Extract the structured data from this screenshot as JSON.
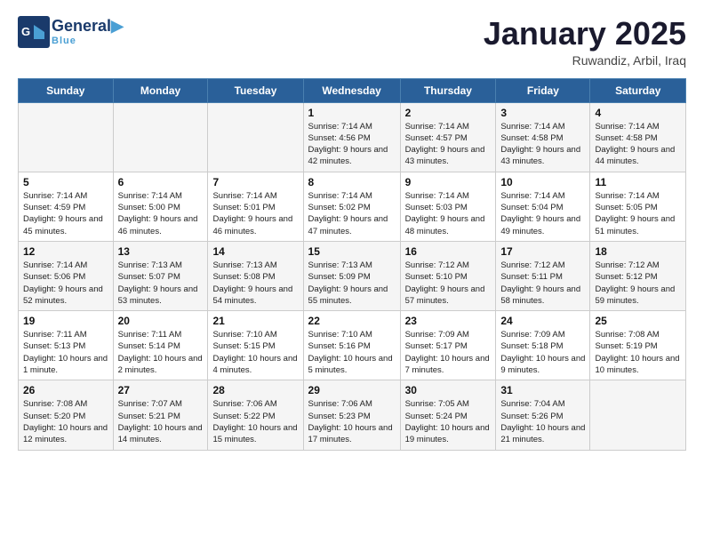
{
  "header": {
    "logo_general": "General",
    "logo_blue": "Blue",
    "title": "January 2025",
    "location": "Ruwandiz, Arbil, Iraq"
  },
  "days_of_week": [
    "Sunday",
    "Monday",
    "Tuesday",
    "Wednesday",
    "Thursday",
    "Friday",
    "Saturday"
  ],
  "weeks": [
    [
      {
        "day": "",
        "sunrise": "",
        "sunset": "",
        "daylight": ""
      },
      {
        "day": "",
        "sunrise": "",
        "sunset": "",
        "daylight": ""
      },
      {
        "day": "",
        "sunrise": "",
        "sunset": "",
        "daylight": ""
      },
      {
        "day": "1",
        "sunrise": "Sunrise: 7:14 AM",
        "sunset": "Sunset: 4:56 PM",
        "daylight": "Daylight: 9 hours and 42 minutes."
      },
      {
        "day": "2",
        "sunrise": "Sunrise: 7:14 AM",
        "sunset": "Sunset: 4:57 PM",
        "daylight": "Daylight: 9 hours and 43 minutes."
      },
      {
        "day": "3",
        "sunrise": "Sunrise: 7:14 AM",
        "sunset": "Sunset: 4:58 PM",
        "daylight": "Daylight: 9 hours and 43 minutes."
      },
      {
        "day": "4",
        "sunrise": "Sunrise: 7:14 AM",
        "sunset": "Sunset: 4:58 PM",
        "daylight": "Daylight: 9 hours and 44 minutes."
      }
    ],
    [
      {
        "day": "5",
        "sunrise": "Sunrise: 7:14 AM",
        "sunset": "Sunset: 4:59 PM",
        "daylight": "Daylight: 9 hours and 45 minutes."
      },
      {
        "day": "6",
        "sunrise": "Sunrise: 7:14 AM",
        "sunset": "Sunset: 5:00 PM",
        "daylight": "Daylight: 9 hours and 46 minutes."
      },
      {
        "day": "7",
        "sunrise": "Sunrise: 7:14 AM",
        "sunset": "Sunset: 5:01 PM",
        "daylight": "Daylight: 9 hours and 46 minutes."
      },
      {
        "day": "8",
        "sunrise": "Sunrise: 7:14 AM",
        "sunset": "Sunset: 5:02 PM",
        "daylight": "Daylight: 9 hours and 47 minutes."
      },
      {
        "day": "9",
        "sunrise": "Sunrise: 7:14 AM",
        "sunset": "Sunset: 5:03 PM",
        "daylight": "Daylight: 9 hours and 48 minutes."
      },
      {
        "day": "10",
        "sunrise": "Sunrise: 7:14 AM",
        "sunset": "Sunset: 5:04 PM",
        "daylight": "Daylight: 9 hours and 49 minutes."
      },
      {
        "day": "11",
        "sunrise": "Sunrise: 7:14 AM",
        "sunset": "Sunset: 5:05 PM",
        "daylight": "Daylight: 9 hours and 51 minutes."
      }
    ],
    [
      {
        "day": "12",
        "sunrise": "Sunrise: 7:14 AM",
        "sunset": "Sunset: 5:06 PM",
        "daylight": "Daylight: 9 hours and 52 minutes."
      },
      {
        "day": "13",
        "sunrise": "Sunrise: 7:13 AM",
        "sunset": "Sunset: 5:07 PM",
        "daylight": "Daylight: 9 hours and 53 minutes."
      },
      {
        "day": "14",
        "sunrise": "Sunrise: 7:13 AM",
        "sunset": "Sunset: 5:08 PM",
        "daylight": "Daylight: 9 hours and 54 minutes."
      },
      {
        "day": "15",
        "sunrise": "Sunrise: 7:13 AM",
        "sunset": "Sunset: 5:09 PM",
        "daylight": "Daylight: 9 hours and 55 minutes."
      },
      {
        "day": "16",
        "sunrise": "Sunrise: 7:12 AM",
        "sunset": "Sunset: 5:10 PM",
        "daylight": "Daylight: 9 hours and 57 minutes."
      },
      {
        "day": "17",
        "sunrise": "Sunrise: 7:12 AM",
        "sunset": "Sunset: 5:11 PM",
        "daylight": "Daylight: 9 hours and 58 minutes."
      },
      {
        "day": "18",
        "sunrise": "Sunrise: 7:12 AM",
        "sunset": "Sunset: 5:12 PM",
        "daylight": "Daylight: 9 hours and 59 minutes."
      }
    ],
    [
      {
        "day": "19",
        "sunrise": "Sunrise: 7:11 AM",
        "sunset": "Sunset: 5:13 PM",
        "daylight": "Daylight: 10 hours and 1 minute."
      },
      {
        "day": "20",
        "sunrise": "Sunrise: 7:11 AM",
        "sunset": "Sunset: 5:14 PM",
        "daylight": "Daylight: 10 hours and 2 minutes."
      },
      {
        "day": "21",
        "sunrise": "Sunrise: 7:10 AM",
        "sunset": "Sunset: 5:15 PM",
        "daylight": "Daylight: 10 hours and 4 minutes."
      },
      {
        "day": "22",
        "sunrise": "Sunrise: 7:10 AM",
        "sunset": "Sunset: 5:16 PM",
        "daylight": "Daylight: 10 hours and 5 minutes."
      },
      {
        "day": "23",
        "sunrise": "Sunrise: 7:09 AM",
        "sunset": "Sunset: 5:17 PM",
        "daylight": "Daylight: 10 hours and 7 minutes."
      },
      {
        "day": "24",
        "sunrise": "Sunrise: 7:09 AM",
        "sunset": "Sunset: 5:18 PM",
        "daylight": "Daylight: 10 hours and 9 minutes."
      },
      {
        "day": "25",
        "sunrise": "Sunrise: 7:08 AM",
        "sunset": "Sunset: 5:19 PM",
        "daylight": "Daylight: 10 hours and 10 minutes."
      }
    ],
    [
      {
        "day": "26",
        "sunrise": "Sunrise: 7:08 AM",
        "sunset": "Sunset: 5:20 PM",
        "daylight": "Daylight: 10 hours and 12 minutes."
      },
      {
        "day": "27",
        "sunrise": "Sunrise: 7:07 AM",
        "sunset": "Sunset: 5:21 PM",
        "daylight": "Daylight: 10 hours and 14 minutes."
      },
      {
        "day": "28",
        "sunrise": "Sunrise: 7:06 AM",
        "sunset": "Sunset: 5:22 PM",
        "daylight": "Daylight: 10 hours and 15 minutes."
      },
      {
        "day": "29",
        "sunrise": "Sunrise: 7:06 AM",
        "sunset": "Sunset: 5:23 PM",
        "daylight": "Daylight: 10 hours and 17 minutes."
      },
      {
        "day": "30",
        "sunrise": "Sunrise: 7:05 AM",
        "sunset": "Sunset: 5:24 PM",
        "daylight": "Daylight: 10 hours and 19 minutes."
      },
      {
        "day": "31",
        "sunrise": "Sunrise: 7:04 AM",
        "sunset": "Sunset: 5:26 PM",
        "daylight": "Daylight: 10 hours and 21 minutes."
      },
      {
        "day": "",
        "sunrise": "",
        "sunset": "",
        "daylight": ""
      }
    ]
  ]
}
